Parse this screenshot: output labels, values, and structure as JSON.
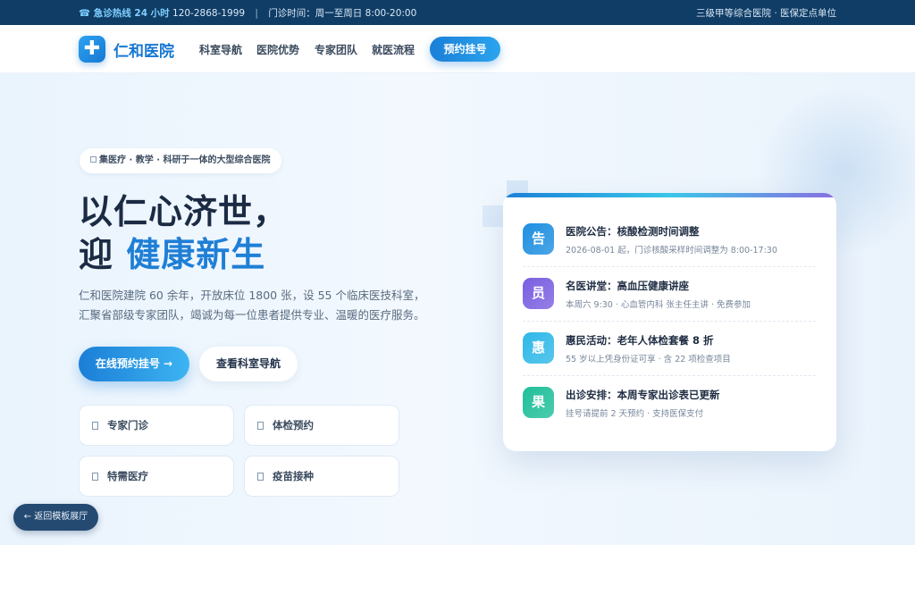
{
  "topbar": {
    "hotline_label": "☎ 急诊热线 24 小时",
    "hotline_number": "120-2868-1999",
    "separator": "|",
    "hours": "门诊时间：周一至周日 8:00-20:00",
    "right_text": "三级甲等综合医院 · 医保定点单位"
  },
  "nav": {
    "logo_icon": "plus-icon",
    "logo_glyph": "✚",
    "brand": "仁和医院",
    "links": [
      "科室导航",
      "医院优势",
      "专家团队",
      "就医流程"
    ],
    "cta": "预约挂号"
  },
  "hero": {
    "badge": "集医疗 · 教学 · 科研于一体的大型综合医院",
    "title_line1": "以仁心济世，",
    "title_line2_prefix": "迎 ",
    "title_line2_highlight": "健康新生",
    "description": "仁和医院建院 60 余年，开放床位 1800 张，设 55 个临床医技科室，汇聚省部级专家团队，竭诚为每一位患者提供专业、温暖的医疗服务。",
    "primary_button": "在线预约挂号 →",
    "secondary_button": "查看科室导航",
    "quick_links": [
      "专家门诊",
      "体检预约",
      "特需医疗",
      "疫苗接种"
    ]
  },
  "notices": [
    {
      "icon": "告",
      "color": "#1f8fe0",
      "title": "医院公告：核酸检测时间调整",
      "subtitle": "2026-08-01 起，门诊核酸采样时间调整为 8:00-17:30"
    },
    {
      "icon": "员",
      "color": "#7a5fe0",
      "title": "名医讲堂：高血压健康讲座",
      "subtitle": "本周六 9:30 · 心血管内科 张主任主讲 · 免费参加"
    },
    {
      "icon": "惠",
      "color": "#2fb8e8",
      "title": "惠民活动：老年人体检套餐 8 折",
      "subtitle": "55 岁以上凭身份证可享 · 含 22 项检查项目"
    },
    {
      "icon": "果",
      "color": "#1fbf9a",
      "title": "出诊安排：本周专家出诊表已更新",
      "subtitle": "挂号请提前 2 天预约 · 支持医保支付"
    }
  ],
  "back_button": "← 返回模板展厅"
}
